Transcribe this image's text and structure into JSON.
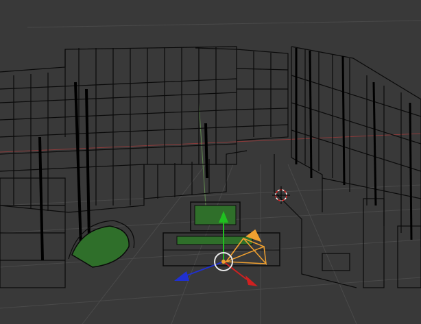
{
  "viewport": {
    "background_color": "#393939",
    "grid_color": "#4a4a4a",
    "wire_color": "#0a0a0a",
    "foliage_color": "#2f6f2a",
    "x_axis_color": "#8c3a3a",
    "y_axis_color": "#5f8a4e",
    "selection_color": "#f0a030"
  },
  "gizmo": {
    "x_arrow_color": "#d02020",
    "y_arrow_color": "#20c020",
    "z_arrow_color": "#2030d0",
    "center_ring_color": "#e8e8e8"
  },
  "cursor_3d": {
    "ring_colors": [
      "#e02020",
      "#ffffff"
    ]
  },
  "icons": {
    "transform_gizmo": "move-manipulator-icon",
    "camera": "camera-icon",
    "cursor": "3d-cursor-icon"
  }
}
